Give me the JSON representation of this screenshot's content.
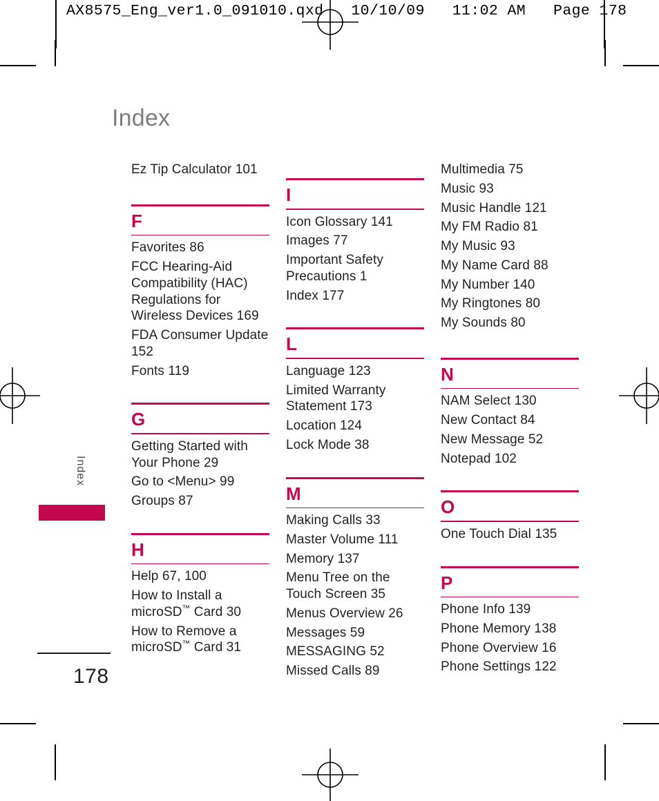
{
  "print_header": {
    "text": "AX8575_Eng_ver1.0_091010.qxd   10/10/09   11:02 AM   Page 178"
  },
  "page": {
    "title": "Index",
    "side_tab_label": "Index",
    "number": "178",
    "accent_color": "#c4074e",
    "title_color": "#7d7d7d"
  },
  "columns": [
    {
      "lead_entries": [
        "Ez Tip Calculator 101"
      ],
      "sections": [
        {
          "letter": "F",
          "entries": [
            "Favorites 86",
            "FCC Hearing-Aid Compatibility (HAC) Regulations for Wireless Devices 169",
            "FDA Consumer Update 152",
            "Fonts 119"
          ]
        },
        {
          "letter": "G",
          "entries": [
            "Getting Started with Your Phone 29",
            "Go to <Menu> 99",
            "Groups 87"
          ]
        },
        {
          "letter": "H",
          "entries": [
            "Help 67, 100",
            "How to Install a microSD™ Card 30",
            "How to Remove a microSD™ Card 31"
          ]
        }
      ]
    },
    {
      "lead_entries": [],
      "sections": [
        {
          "letter": "I",
          "entries": [
            "Icon Glossary 141",
            "Images 77",
            "Important Safety Precautions 1",
            "Index 177"
          ]
        },
        {
          "letter": "L",
          "entries": [
            "Language 123",
            "Limited Warranty Statement 173",
            "Location 124",
            "Lock Mode 38"
          ]
        },
        {
          "letter": "M",
          "entries": [
            "Making Calls 33",
            "Master Volume 111",
            "Memory 137",
            "Menu Tree on the Touch Screen 35",
            "Menus Overview 26",
            "Messages 59",
            "MESSAGING 52",
            "Missed Calls 89"
          ]
        }
      ]
    },
    {
      "lead_entries": [
        "Multimedia 75",
        "Music 93",
        "Music Handle 121",
        "My FM Radio 81",
        "My Music 93",
        "My Name Card 88",
        "My Number 140",
        "My Ringtones 80",
        "My Sounds 80"
      ],
      "sections": [
        {
          "letter": "N",
          "entries": [
            "NAM Select 130",
            "New Contact 84",
            "New Message 52",
            "Notepad 102"
          ]
        },
        {
          "letter": "O",
          "entries": [
            "One Touch Dial 135"
          ]
        },
        {
          "letter": "P",
          "entries": [
            "Phone Info 139",
            "Phone Memory 138",
            "Phone Overview 16",
            "Phone Settings 122"
          ]
        }
      ]
    }
  ]
}
